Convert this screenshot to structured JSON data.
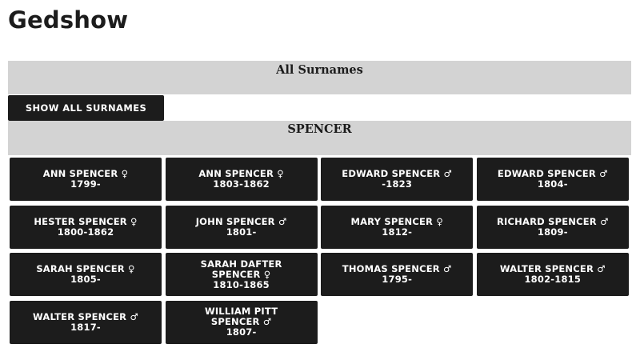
{
  "app": {
    "title": "Gedshow"
  },
  "all_surnames": {
    "heading": "All Surnames",
    "show_all_label": "SHOW ALL SURNAMES"
  },
  "surname": {
    "heading": "SPENCER"
  },
  "people": [
    {
      "name": "ANN SPENCER",
      "sex": "♀",
      "dates": "1799-"
    },
    {
      "name": "ANN SPENCER",
      "sex": "♀",
      "dates": "1803-1862"
    },
    {
      "name": "EDWARD SPENCER",
      "sex": "♂",
      "dates": "-1823"
    },
    {
      "name": "EDWARD SPENCER",
      "sex": "♂",
      "dates": "1804-"
    },
    {
      "name": "HESTER SPENCER",
      "sex": "♀",
      "dates": "1800-1862"
    },
    {
      "name": "JOHN SPENCER",
      "sex": "♂",
      "dates": "1801-"
    },
    {
      "name": "MARY SPENCER",
      "sex": "♀",
      "dates": "1812-"
    },
    {
      "name": "RICHARD SPENCER",
      "sex": "♂",
      "dates": "1809-"
    },
    {
      "name": "SARAH SPENCER",
      "sex": "♀",
      "dates": "1805-"
    },
    {
      "name": "SARAH DAFTER SPENCER",
      "sex": "♀",
      "dates": "1810-1865",
      "wrap": true
    },
    {
      "name": "THOMAS SPENCER",
      "sex": "♂",
      "dates": "1795-"
    },
    {
      "name": "WALTER SPENCER",
      "sex": "♂",
      "dates": "1802-1815"
    },
    {
      "name": "WALTER SPENCER",
      "sex": "♂",
      "dates": "1817-"
    },
    {
      "name": "WILLIAM PITT SPENCER",
      "sex": "♂",
      "dates": "1807-",
      "wrap": true
    }
  ]
}
